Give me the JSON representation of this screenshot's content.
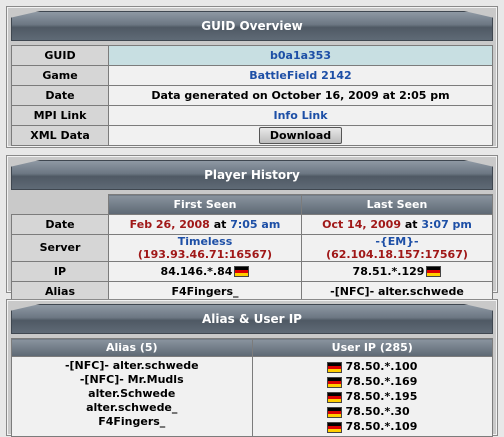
{
  "guid_overview": {
    "title": "GUID Overview",
    "rows": {
      "guid_label": "GUID",
      "guid_value": "b0a1a353",
      "game_label": "Game",
      "game_value": "BattleField 2142",
      "date_label": "Date",
      "date_value": "Data generated on October 16, 2009 at 2:05 pm",
      "mpi_label": "MPI Link",
      "mpi_value": "Info Link",
      "xml_label": "XML Data",
      "xml_button": "Download"
    }
  },
  "player_history": {
    "title": "Player History",
    "first_seen_header": "First Seen",
    "last_seen_header": "Last Seen",
    "date_label": "Date",
    "first_date": "Feb 26, 2008",
    "first_at": "at",
    "first_time": "7:05 am",
    "last_date": "Oct 14, 2009",
    "last_at": "at",
    "last_time": "3:07 pm",
    "server_label": "Server",
    "first_server_name": "Timeless",
    "first_server_addr": "(193.93.46.71:16567)",
    "last_server_name": "-{EM}-",
    "last_server_addr": "(62.104.18.157:17567)",
    "ip_label": "IP",
    "first_ip": "84.146.*.84",
    "last_ip": "78.51.*.129",
    "alias_label": "Alias",
    "first_alias": "F4Fingers_",
    "last_alias": "-[NFC]- alter.schwede"
  },
  "alias_user_ip": {
    "title": "Alias & User IP",
    "alias_header": "Alias (5)",
    "ip_header": "User IP (285)",
    "aliases": [
      "-[NFC]- alter.schwede",
      "-[NFC]- Mr.Mudls",
      "alter.Schwede",
      "alter.schwede_",
      "F4Fingers_"
    ],
    "ips": [
      "78.50.*.100",
      "78.50.*.169",
      "78.50.*.195",
      "78.50.*.30",
      "78.50.*.109"
    ]
  },
  "flag_colors": {
    "black": "#000000",
    "red": "#dd0000",
    "gold": "#ffce00"
  },
  "icons": {
    "flag": "germany-flag-icon"
  }
}
